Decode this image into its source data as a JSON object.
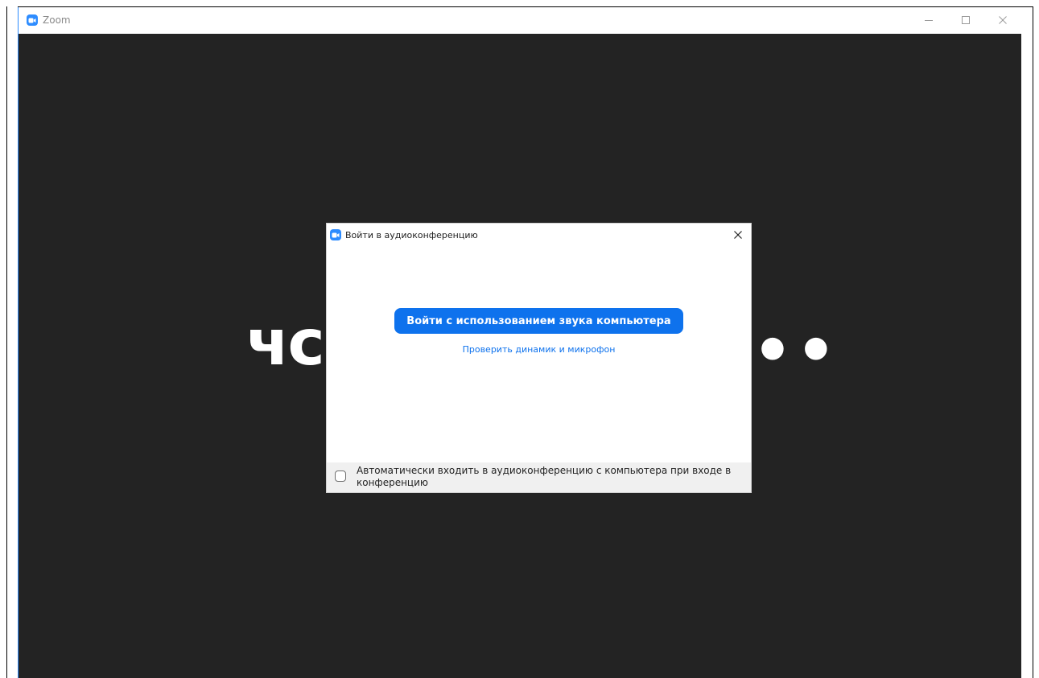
{
  "window": {
    "title": "Zoom"
  },
  "background": {
    "text_left": "чс",
    "text_right": "••"
  },
  "dialog": {
    "title": "Войти в аудиоконференцию",
    "join_button_label": "Войти с использованием звука компьютера",
    "test_link_label": "Проверить динамик и микрофон",
    "auto_join_label": "Автоматически входить в аудиоконференцию с компьютера при входе в конференцию",
    "auto_join_checked": false
  },
  "colors": {
    "accent": "#0e72ed",
    "video_background": "#232323",
    "footer_background": "#f0f0f0"
  },
  "icons": {
    "app": "zoom-camera-icon",
    "minimize": "minimize-icon",
    "maximize": "maximize-icon",
    "close": "close-icon"
  }
}
